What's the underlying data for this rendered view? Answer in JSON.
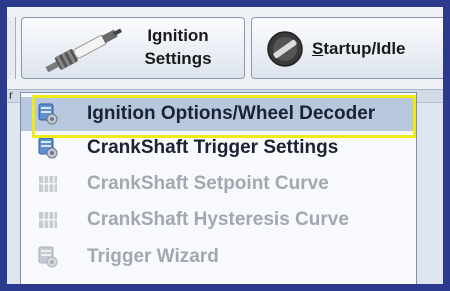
{
  "toolbar": {
    "ignition_button": {
      "line1": "Ignition",
      "line2": "Settings",
      "icon": "spark-plug-icon"
    },
    "startup_button": {
      "label_underlined": "S",
      "label_rest": "tartup/Idle",
      "icon": "dial-knob-icon"
    }
  },
  "header_fragment": "r",
  "menu": {
    "items": [
      {
        "label": "Ignition Options/Wheel Decoder",
        "enabled": true,
        "highlighted": true,
        "icon": "settings-dialog-icon"
      },
      {
        "label": "CrankShaft Trigger Settings",
        "enabled": true,
        "highlighted": false,
        "icon": "settings-dialog-icon"
      },
      {
        "label": "CrankShaft Setpoint Curve",
        "enabled": false,
        "highlighted": false,
        "icon": "curve-table-icon"
      },
      {
        "label": "CrankShaft Hysteresis Curve",
        "enabled": false,
        "highlighted": false,
        "icon": "curve-table-icon"
      },
      {
        "label": "Trigger Wizard",
        "enabled": false,
        "highlighted": false,
        "icon": "settings-dialog-icon"
      }
    ]
  },
  "colors": {
    "frame": "#2b3a8c",
    "highlight_border": "#f0ea1a",
    "menu_selected": "#b7c8de",
    "text_enabled": "#1b2233",
    "text_disabled": "#a2a8b1"
  }
}
